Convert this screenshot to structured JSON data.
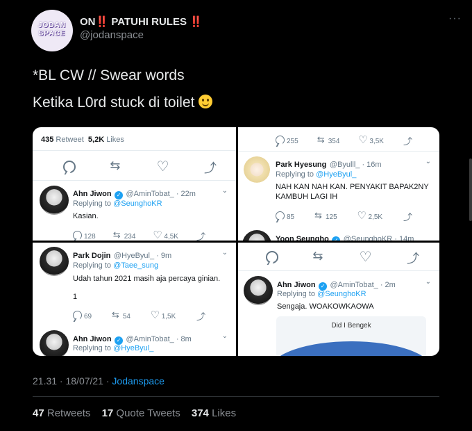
{
  "tweet": {
    "display_name": "ON‼️ PATUHI RULES ‼️",
    "avatar_text": "JODAN SPACE",
    "handle": "@jodanspace",
    "more_icon": "more-icon",
    "line1": "*BL CW // Swear words",
    "line2": "Ketika L0rd stuck di toilet",
    "timestamp": "21.31 · 18/07/21 · ",
    "source": "Jodanspace",
    "retweets_count": "47",
    "retweets_label": "Retweets",
    "quote_count": "17",
    "quote_label": "Quote Tweets",
    "likes_count": "374",
    "likes_label": "Likes"
  },
  "panel1": {
    "retweet_count": "435",
    "retweet_label": "Retweet",
    "likes_count": "5,2K",
    "likes_label": "Likes",
    "reply_name": "Ahn Jiwon",
    "reply_handle": "@AminTobat_ · 22m",
    "replying_prefix": "Replying to ",
    "replying_to": "@SeunghoKR",
    "reply_text": "Kasian.",
    "stat_replies": "128",
    "stat_retweets": "234",
    "stat_likes": "4,5K"
  },
  "panel2": {
    "stat_replies": "255",
    "stat_retweets": "354",
    "stat_likes": "3,5K",
    "reply_name": "Park Hyesung",
    "reply_handle": "@Byulll_ · 16m",
    "replying_prefix": "Replying to ",
    "replying_to": "@HyeByul_",
    "reply_text_1": "NAH KAN NAH KAN. PENYAKIT BAPAK2NY",
    "reply_text_2": "KAMBUH LAGI IH",
    "stat2_replies": "85",
    "stat2_retweets": "125",
    "stat2_likes": "2,5K",
    "next_name": "Yoon Seungho",
    "next_handle": "@SeunghoKR · 14m"
  },
  "panel3": {
    "reply_name": "Park Dojin",
    "reply_handle": "@HyeByul_ · 9m",
    "replying_prefix": "Replying to ",
    "replying_to": "@Taee_sung",
    "reply_text": "Udah tahun 2021 masih aja percaya ginian.",
    "reply_text_2": "1",
    "stat_replies": "69",
    "stat_retweets": "54",
    "stat_likes": "1,5K",
    "next_name": "Ahn Jiwon",
    "next_handle": "@AminTobat_ · 8m",
    "next_replying_to": "@HyeByul_"
  },
  "panel4": {
    "reply_name": "Ahn Jiwon",
    "reply_handle": "@AminTobat_ · 2m",
    "replying_prefix": "Replying to ",
    "replying_to": "@SeunghoKR",
    "reply_text": "Sengaja. WOAKOWKAOWA",
    "image_title": "Did I Bengek"
  }
}
